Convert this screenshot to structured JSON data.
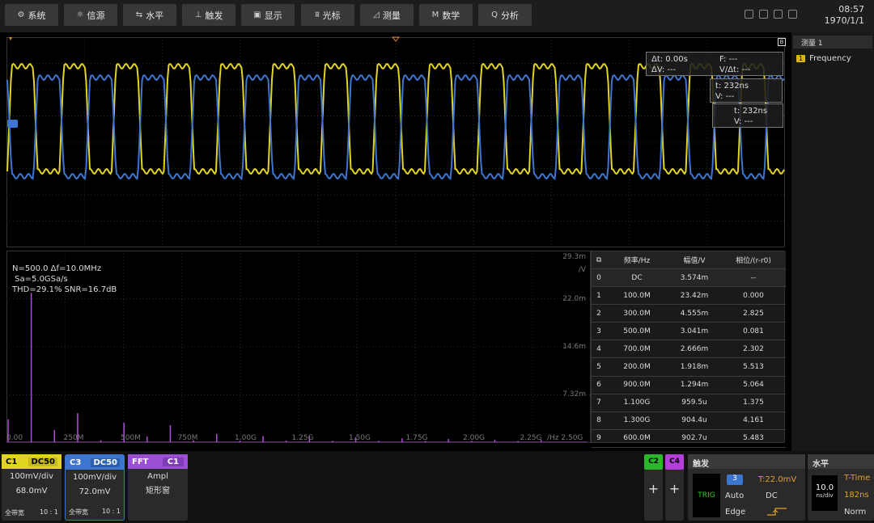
{
  "toolbar": {
    "items": [
      {
        "label": "系统",
        "icon": "gear-icon",
        "glyph": "⚙"
      },
      {
        "label": "信源",
        "icon": "source-icon",
        "glyph": "⚛"
      },
      {
        "label": "水平",
        "icon": "horizontal-icon",
        "glyph": "⇆"
      },
      {
        "label": "触发",
        "icon": "trigger-icon",
        "glyph": "⊥"
      },
      {
        "label": "显示",
        "icon": "display-icon",
        "glyph": "▣"
      },
      {
        "label": "光标",
        "icon": "cursor-icon",
        "glyph": "⩩"
      },
      {
        "label": "测量",
        "icon": "measure-icon",
        "glyph": "◿"
      },
      {
        "label": "数学",
        "icon": "math-icon",
        "glyph": "M"
      },
      {
        "label": "分析",
        "icon": "analyze-icon",
        "glyph": "Q"
      }
    ]
  },
  "clock": {
    "time": "08:57",
    "date": "1970/1/1"
  },
  "measure": {
    "title": "测量 1",
    "num": "1",
    "item": "Frequency"
  },
  "cursors": {
    "delta_t": "Δt: 0.00s",
    "f": "F: ---",
    "delta_v": "ΔV: ---",
    "v_dt": "V/Δt: ---",
    "c1_t": "t: 232ns",
    "c1_v": "V: ---",
    "c2_t": "t: 232ns",
    "c2_v": "V: ---"
  },
  "scope": {
    "badge": "B"
  },
  "fft": {
    "info": [
      "N=500.0 Δf=10.0MHz",
      " Sa=5.0GSa/s",
      "THD=29.1% SNR=16.7dB"
    ],
    "ylabels": [
      "29.3m",
      "/V",
      "22.0m",
      "14.6m",
      "7.32m"
    ],
    "xlabels": [
      "0.00",
      "250M",
      "500M",
      "750M",
      "1.00G",
      "1.25G",
      "1.50G",
      "1.75G",
      "2.00G",
      "2.25G",
      "/Hz 2.50G"
    ]
  },
  "table": {
    "headers": [
      "频率/Hz",
      "幅值/V",
      "相位/(r-r0)"
    ],
    "rows": [
      [
        "0",
        "DC",
        "3.574m",
        "--"
      ],
      [
        "1",
        "100.0M",
        "23.42m",
        "0.000"
      ],
      [
        "2",
        "300.0M",
        "4.555m",
        "2.825"
      ],
      [
        "3",
        "500.0M",
        "3.041m",
        "0.081"
      ],
      [
        "4",
        "700.0M",
        "2.666m",
        "2.302"
      ],
      [
        "5",
        "200.0M",
        "1.918m",
        "5.513"
      ],
      [
        "6",
        "900.0M",
        "1.294m",
        "5.064"
      ],
      [
        "7",
        "1.100G",
        "959.5u",
        "1.375"
      ],
      [
        "8",
        "1.300G",
        "904.4u",
        "4.161"
      ],
      [
        "9",
        "600.0M",
        "902.7u",
        "5.483"
      ]
    ]
  },
  "chart_data": {
    "type": "bar",
    "x": [
      0,
      100,
      200,
      300,
      400,
      500,
      600,
      700,
      800,
      900,
      1000,
      1100,
      1200,
      1300,
      1400,
      1500,
      1600,
      1700,
      1800,
      1900,
      2000,
      2100,
      2200,
      2300
    ],
    "values": [
      3.574,
      23.42,
      1.918,
      4.555,
      0.3,
      3.041,
      0.9027,
      2.666,
      0.3,
      1.294,
      0.25,
      0.9595,
      0.25,
      0.9044,
      0.2,
      0.8,
      0.2,
      0.6,
      0.2,
      0.5,
      0.2,
      0.4,
      0.2,
      0.35
    ],
    "xunit": "MHz",
    "yunit": "mV",
    "ylim": [
      0,
      29.3
    ]
  },
  "channels": {
    "c1": {
      "name": "C1",
      "coupling": "DC50",
      "scale": "100mV/div",
      "offset": "68.0mV",
      "bw": "全带宽",
      "probe": "10 : 1"
    },
    "c3": {
      "name": "C3",
      "coupling": "DC50",
      "scale": "100mV/div",
      "offset": "72.0mV",
      "bw": "全带宽",
      "probe": "10 : 1"
    },
    "fft": {
      "name": "FFT",
      "src": "C1",
      "mode": "Ampl",
      "window": "矩形窗"
    },
    "c2": "C2",
    "c4": "C4",
    "plus": "+",
    "colors": {
      "c1": "#e2d522",
      "c3": "#3d75cf",
      "fft": "#9b4fd6",
      "c2": "#2db52d",
      "c4": "#b43fd8"
    }
  },
  "trigger": {
    "title": "触发",
    "trig": "TRIG",
    "src": "3",
    "mode": "Auto",
    "level": "T:22.0mV",
    "coupling": "DC",
    "type": "Edge"
  },
  "horizontal": {
    "title": "水平",
    "scale": "10.0",
    "unit": "ns/div",
    "ttime": "T-Time",
    "pos": "182ns",
    "mode": "Norm"
  }
}
